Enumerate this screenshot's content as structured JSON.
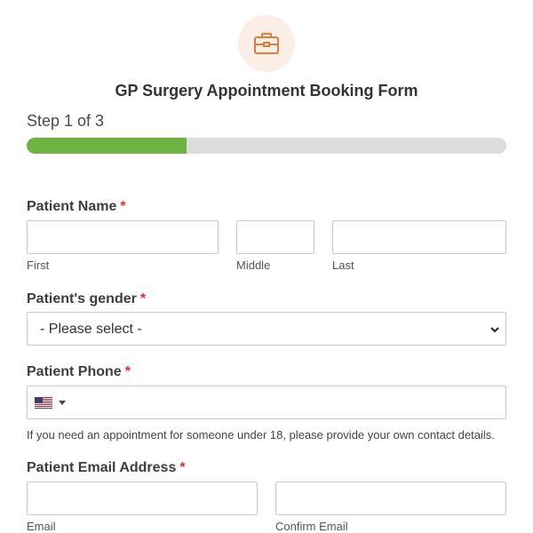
{
  "header": {
    "logo_icon": "briefcase-icon",
    "title": "GP Surgery Appointment Booking Form"
  },
  "progress": {
    "step_label": "Step 1 of 3",
    "fraction": 0.333,
    "fill_color": "#6db33f",
    "track_color": "#dcdcdc"
  },
  "fields": {
    "patient_name": {
      "label": "Patient Name",
      "required_mark": "*",
      "first_sublabel": "First",
      "middle_sublabel": "Middle",
      "last_sublabel": "Last",
      "first_value": "",
      "middle_value": "",
      "last_value": ""
    },
    "gender": {
      "label": "Patient's gender",
      "required_mark": "*",
      "selected": "- Please select -"
    },
    "phone": {
      "label": "Patient Phone",
      "required_mark": "*",
      "country_flag_icon": "us-flag-icon",
      "value": "",
      "help_text": "If you need an appointment for someone under 18, please provide your own contact details."
    },
    "email": {
      "label": "Patient Email Address",
      "required_mark": "*",
      "email_sublabel": "Email",
      "confirm_sublabel": "Confirm Email",
      "email_value": "",
      "confirm_value": ""
    }
  },
  "colors": {
    "accent_orange": "#e07b39",
    "required_red": "#e03030"
  }
}
